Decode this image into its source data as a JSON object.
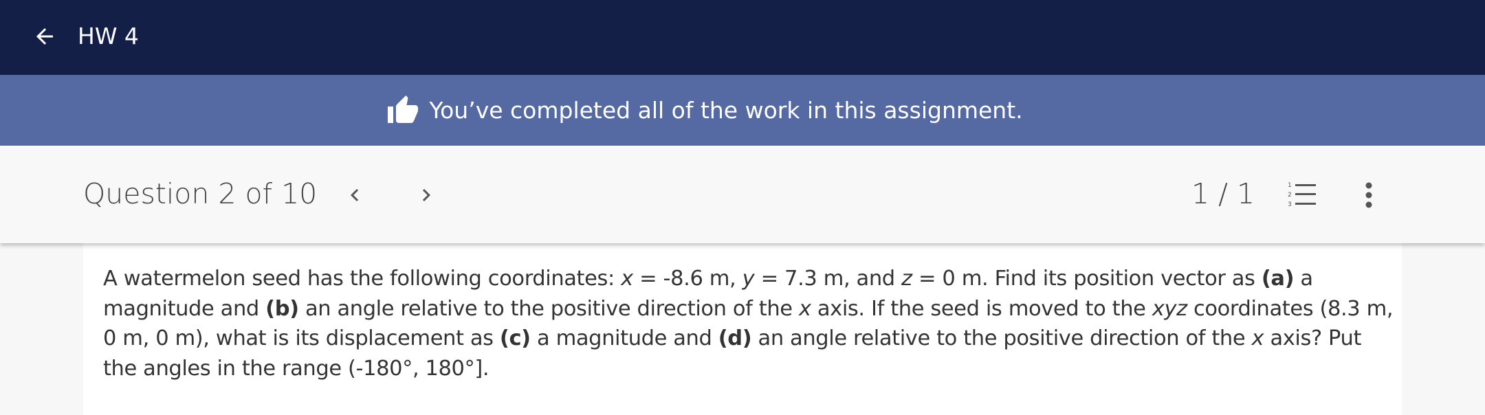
{
  "header": {
    "title": "HW 4",
    "back_icon": "arrow-left-icon"
  },
  "banner": {
    "icon": "thumbs-up-icon",
    "message": "You’ve completed all of the work in this assignment."
  },
  "question_bar": {
    "counter": "Question 2 of 10",
    "prev_icon": "chevron-left-icon",
    "next_icon": "chevron-right-icon",
    "part_counter": "1 / 1",
    "list_icon": "numbered-list-icon",
    "more_icon": "more-vertical-icon"
  },
  "question": {
    "segments": [
      {
        "t": "A watermelon seed has the following coordinates: ",
        "s": ""
      },
      {
        "t": "x",
        "s": "i"
      },
      {
        "t": " = -8.6 m, ",
        "s": ""
      },
      {
        "t": "y",
        "s": "i"
      },
      {
        "t": " = 7.3 m, and ",
        "s": ""
      },
      {
        "t": "z",
        "s": "i"
      },
      {
        "t": " = 0 m. Find its position vector as ",
        "s": ""
      },
      {
        "t": "(a)",
        "s": "b"
      },
      {
        "t": " a magnitude and ",
        "s": ""
      },
      {
        "t": "(b)",
        "s": "b"
      },
      {
        "t": " an angle relative to the positive direction of the ",
        "s": ""
      },
      {
        "t": "x",
        "s": "i"
      },
      {
        "t": " axis. If the seed is moved to the ",
        "s": ""
      },
      {
        "t": "xyz",
        "s": "i"
      },
      {
        "t": " coordinates (8.3 m, 0 m, 0 m), what is its displacement as ",
        "s": ""
      },
      {
        "t": "(c)",
        "s": "b"
      },
      {
        "t": " a magnitude and ",
        "s": ""
      },
      {
        "t": "(d)",
        "s": "b"
      },
      {
        "t": " an angle relative to the positive direction of the ",
        "s": ""
      },
      {
        "t": "x",
        "s": "i"
      },
      {
        "t": " axis? Put the angles in the range (-180°, 180°].",
        "s": ""
      }
    ]
  },
  "colors": {
    "topbar": "#131f47",
    "banner": "#5569a3",
    "qbar": "#f8f8f8",
    "text": "#333333"
  }
}
